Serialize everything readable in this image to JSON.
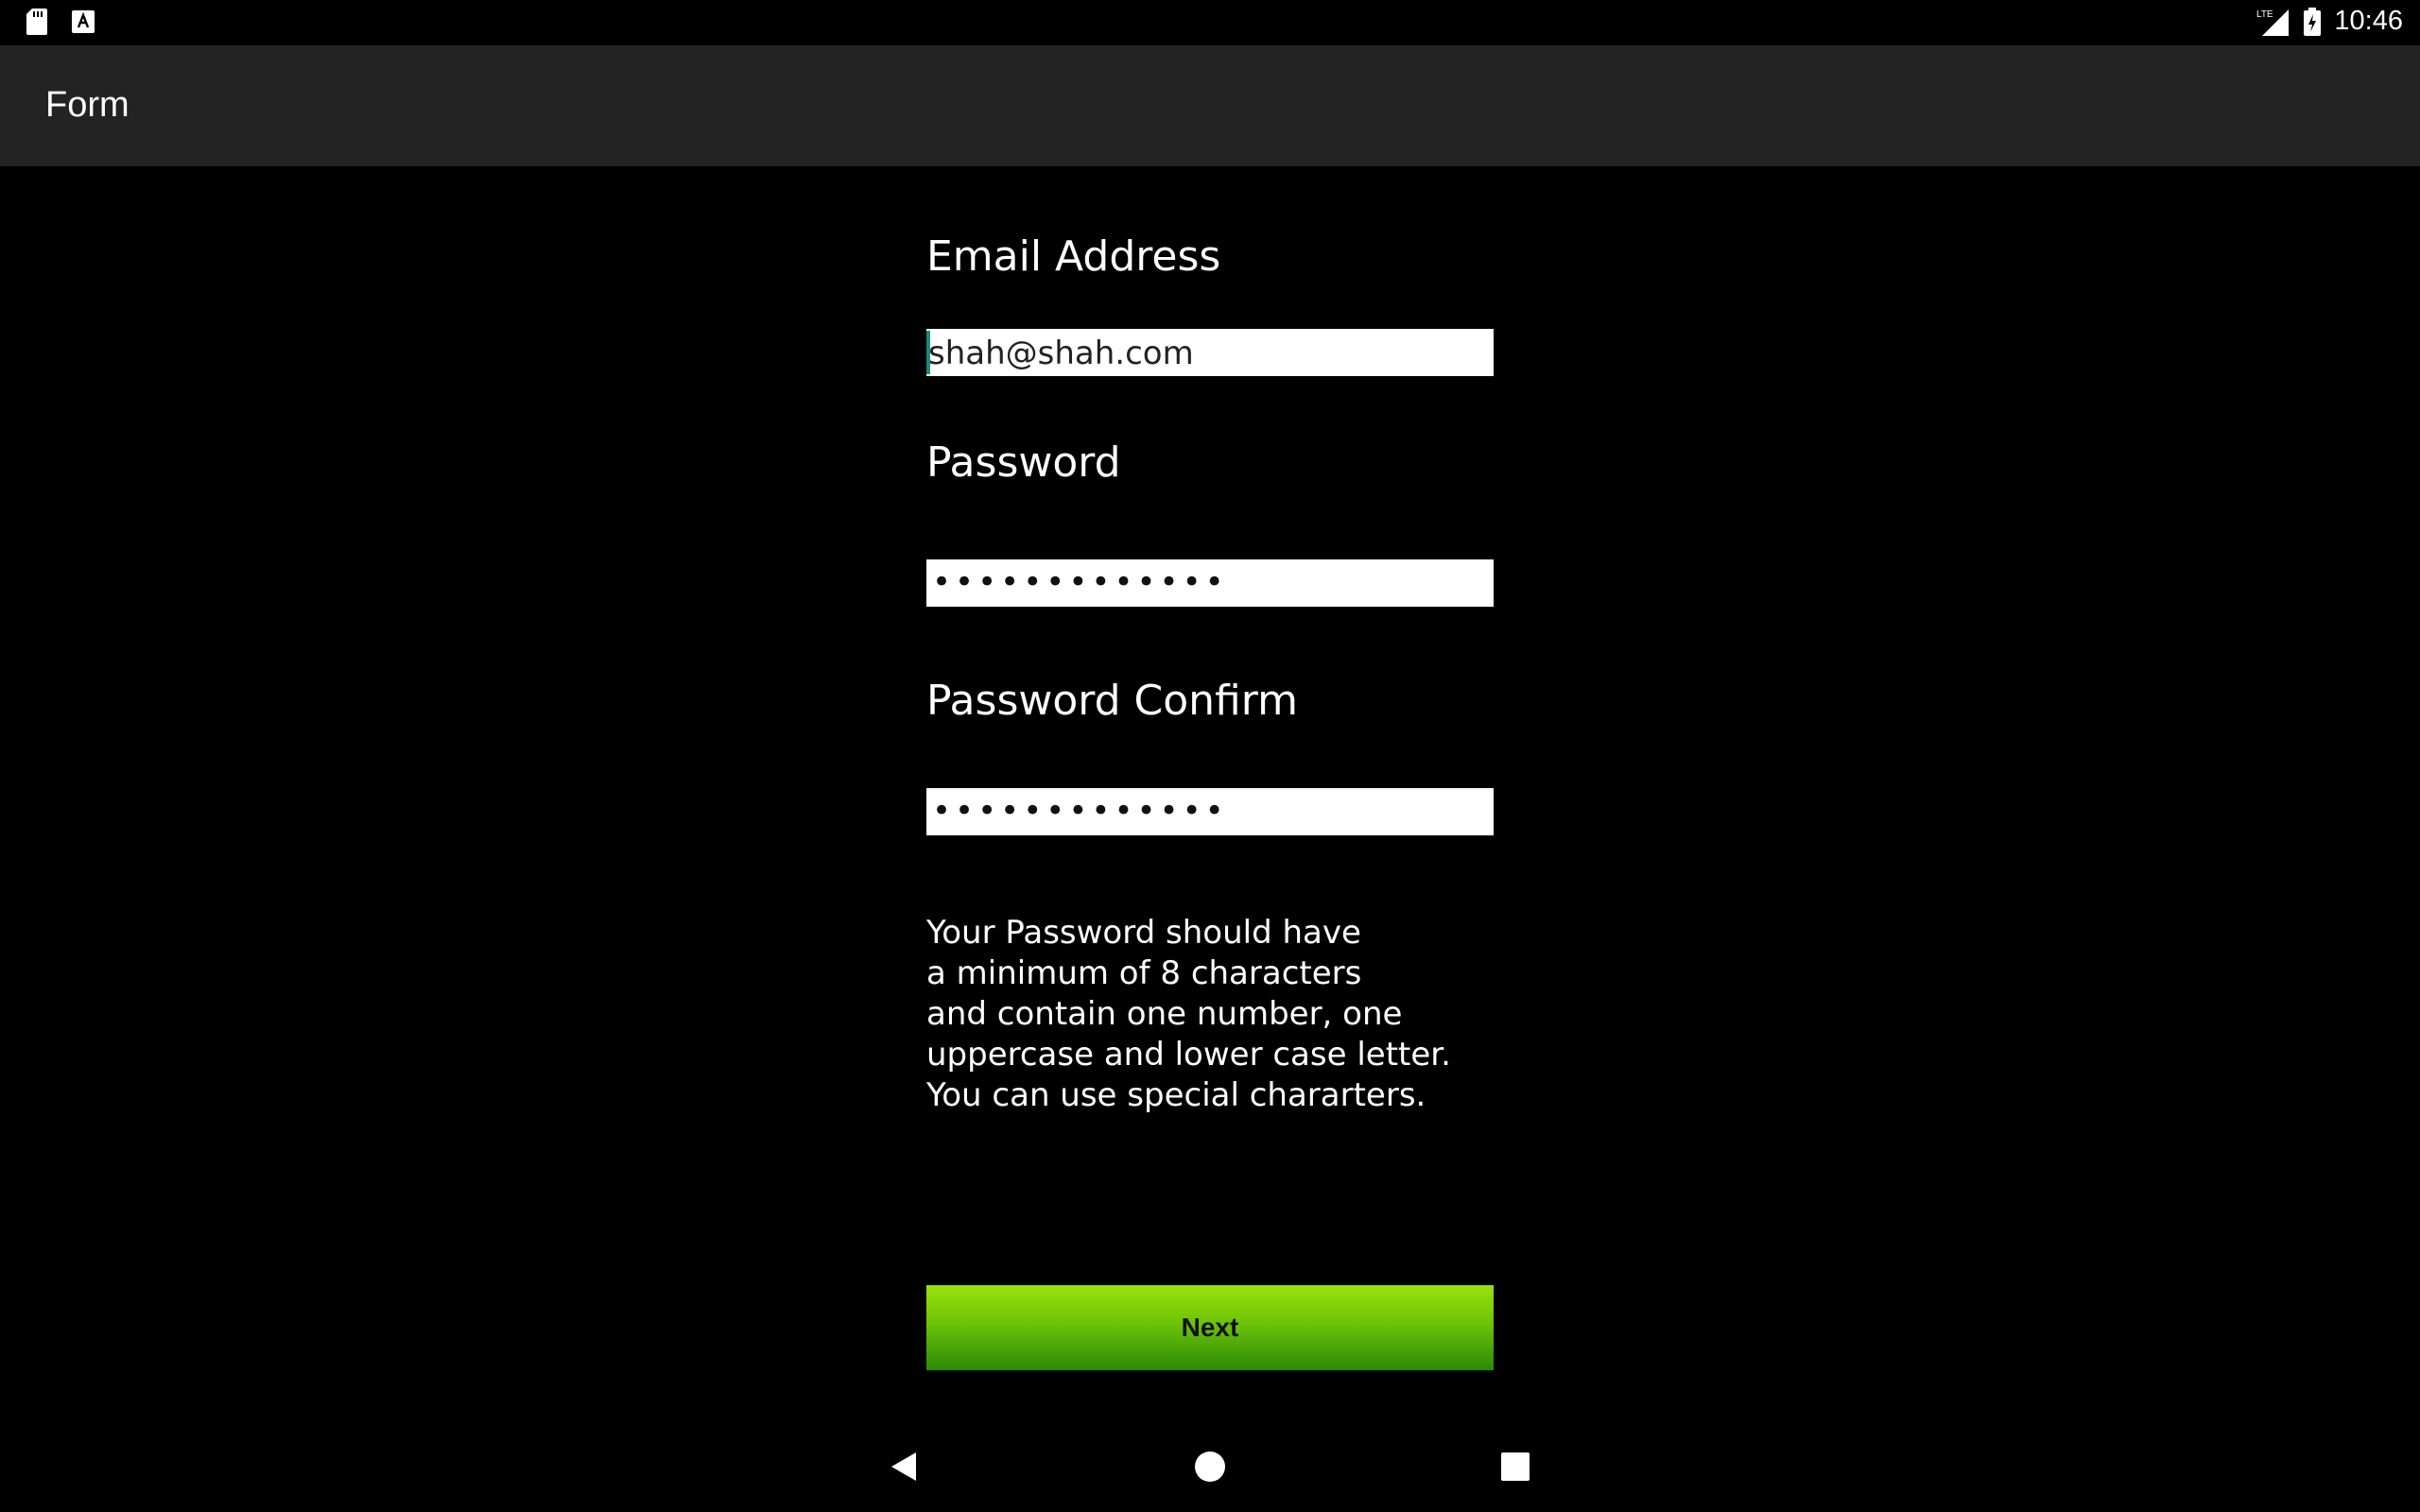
{
  "status_bar": {
    "time": "10:46",
    "icons": [
      "sd-card-icon",
      "a-notification-icon",
      "lte-signal-icon",
      "battery-charging-icon"
    ],
    "network_label": "LTE"
  },
  "app_bar": {
    "title": "Form"
  },
  "form": {
    "email": {
      "label": "Email Address",
      "value": "shah@shah.com"
    },
    "password": {
      "label": "Password",
      "masked_value": "•••••••••••••"
    },
    "password_confirm": {
      "label": "Password Confirm",
      "masked_value": "•••••••••••••"
    },
    "help_lines": [
      "Your Password should have",
      "a minimum of 8 characters",
      "and contain one number, one",
      "uppercase and lower case letter.",
      "You can use special chararters."
    ],
    "next_label": "Next"
  },
  "nav_bar": {
    "icons": [
      "back-icon",
      "home-icon",
      "recents-icon"
    ]
  },
  "colors": {
    "background": "#000000",
    "app_bar": "#232323",
    "button_top": "#9be20a",
    "button_bottom": "#2c8a07",
    "cursor": "#1a8a7a"
  }
}
